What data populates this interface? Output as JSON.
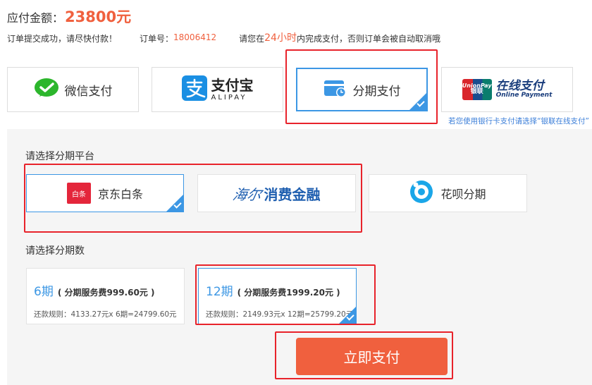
{
  "header": {
    "amount_label": "应付金额：",
    "amount_value": "23800元",
    "submit_msg": "订单提交成功，请尽快付款！",
    "order_label": "订单号：",
    "order_no": "18006412",
    "notice_pre": "请您在",
    "notice_time": "24小时",
    "notice_post": "内完成支付，否则订单会被自动取消哦"
  },
  "pay_methods": [
    {
      "label": "微信支付",
      "icon": "wechat-icon"
    },
    {
      "label": "支付宝",
      "sub": "ALIPAY",
      "icon": "alipay-icon"
    },
    {
      "label": "分期支付",
      "icon": "installment-wallet-icon",
      "selected": true
    },
    {
      "label": "在线支付",
      "sub": "Online Payment",
      "logo_top": "UnionPay",
      "logo_bot": "银联",
      "icon": "unionpay-logo"
    }
  ],
  "union_hint": "若您使用银行卡支付请选择“银联在线支付”",
  "installment": {
    "platform_title": "请选择分期平台",
    "platforms": [
      {
        "label": "京东白条",
        "badge": "白条",
        "icon": "jd-baitiao-logo",
        "selected": true
      },
      {
        "label": "消费金融",
        "script": "海尔",
        "icon": "haier-consumer-finance-logo"
      },
      {
        "label": "花呗分期",
        "icon": "huabei-logo"
      }
    ],
    "terms_title": "请选择分期数",
    "terms": [
      {
        "count": "6期",
        "fee": "( 分期服务费999.60元 )",
        "rule": "还款规则：4133.27元x 6期=24799.60元"
      },
      {
        "count": "12期",
        "fee": "( 分期服务费1999.20元 )",
        "rule": "还款规则：2149.93元x 12期=25799.20元",
        "selected": true
      }
    ]
  },
  "pay_now_label": "立即支付",
  "colors": {
    "accent": "#3c97e4",
    "price": "#f0603e",
    "frame": "#e8232b"
  }
}
